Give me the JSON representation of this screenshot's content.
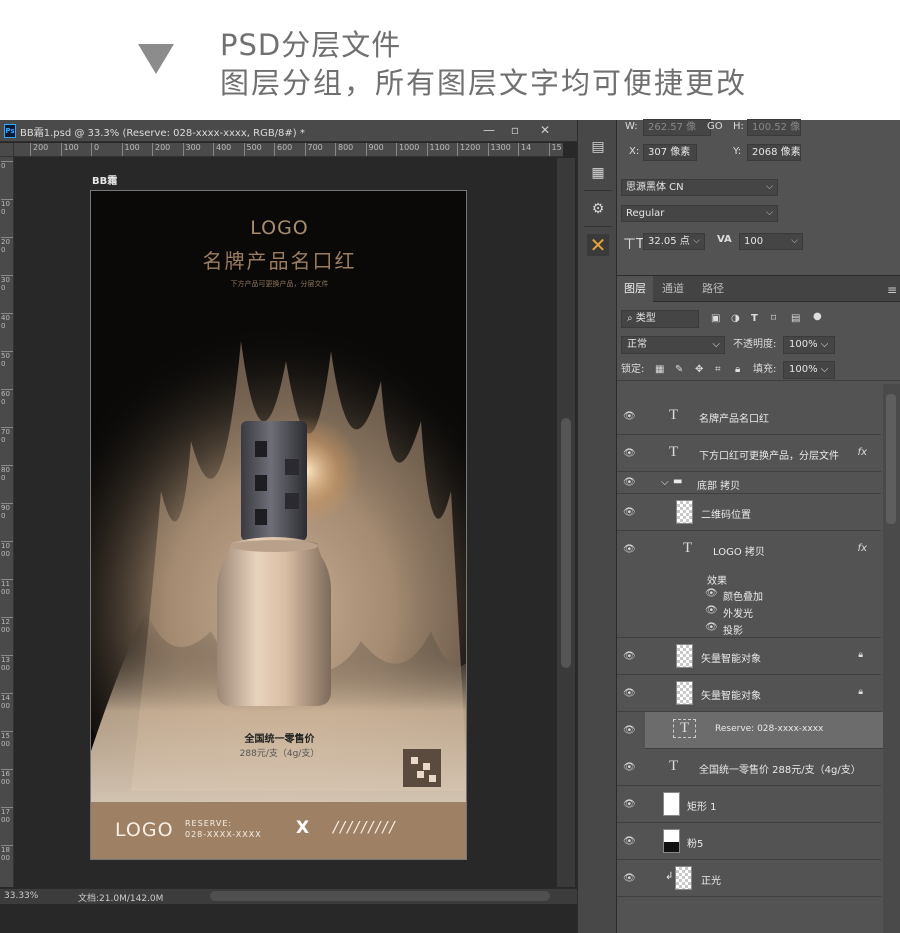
{
  "header": {
    "line1": "PSD分层文件",
    "line2": "图层分组，所有图层文字均可便捷更改"
  },
  "document": {
    "title": "BB霜1.psd @ 33.3% (Reserve: 028-xxxx-xxxx, RGB/8#) *",
    "ps_badge": "Ps",
    "ruler_ticks": [
      "200",
      "100",
      "0",
      "100",
      "200",
      "300",
      "400",
      "500",
      "600",
      "700",
      "800",
      "900",
      "1000",
      "1100",
      "1200",
      "1300",
      "14",
      "15"
    ],
    "vruler_ticks": [
      "0",
      "100",
      "200",
      "300",
      "400",
      "500",
      "600",
      "700",
      "800",
      "900",
      "1000",
      "1100",
      "1200",
      "1300",
      "1400",
      "1500",
      "1600",
      "1700",
      "1800"
    ],
    "artboard_label": "BB霜",
    "zoom": "33.33%",
    "doc_size": "文档:21.0M/142.0M"
  },
  "poster": {
    "logo_top": "LOGO",
    "product_name": "名牌产品名口红",
    "subline": "下方产品可更换产品，分层文件",
    "price_title": "全国统一零售价",
    "price_value": "288元/支（4g/支）",
    "footer_logo": "LOGO",
    "reserve_label": "RESERVE:",
    "reserve_number": "028-XXXX-XXXX",
    "close_mark": "X",
    "slashes": "/////////"
  },
  "toolstrip": {
    "tools": [
      "history-icon",
      "notes-icon",
      "adjust-icon",
      "character-icon"
    ]
  },
  "character_panel": {
    "w_label": "W:",
    "w_value": "262.57 像",
    "h_label": "H:",
    "h_value": "100.52 像",
    "go_label": "GO",
    "x_label": "X:",
    "x_value": "307 像素",
    "y_label": "Y:",
    "y_value": "2068 像素",
    "font_family": "思源黑体 CN",
    "font_style": "Regular",
    "font_size": "32.05 点",
    "tracking": "100"
  },
  "layers_panel": {
    "tabs": [
      "图层",
      "通道",
      "路径"
    ],
    "filter_kind": "类型",
    "blend_mode": "正常",
    "opacity_label": "不透明度:",
    "opacity_value": "100%",
    "lock_label": "锁定:",
    "fill_label": "填充:",
    "fill_value": "100%",
    "layers": [
      {
        "name": "名牌产品名口红",
        "type": "text"
      },
      {
        "name": "下方口红可更换产品，分层文件",
        "type": "text",
        "fx": "fx"
      },
      {
        "name": "底部 拷贝",
        "type": "group"
      },
      {
        "name": "二维码位置",
        "type": "image"
      },
      {
        "name": "LOGO 拷贝",
        "type": "text",
        "fx": "fx"
      },
      {
        "name": "效果",
        "type": "effect-header"
      },
      {
        "name": "颜色叠加",
        "type": "effect"
      },
      {
        "name": "外发光",
        "type": "effect"
      },
      {
        "name": "投影",
        "type": "effect"
      },
      {
        "name": "矢量智能对象",
        "type": "smart"
      },
      {
        "name": "矢量智能对象",
        "type": "smart"
      },
      {
        "name": "Reserve: 028-xxxx-xxxx",
        "type": "text-selected"
      },
      {
        "name": "全国统一零售价 288元/支（4g/支）",
        "type": "text"
      },
      {
        "name": "矩形 1",
        "type": "shape"
      },
      {
        "name": "粉5",
        "type": "image"
      },
      {
        "name": "正光",
        "type": "image"
      }
    ]
  },
  "colors": {
    "ps_dark": "#282828",
    "ps_panel": "#535353",
    "poster_footer": "#9e8065",
    "accent_orange": "#e8a33a"
  }
}
